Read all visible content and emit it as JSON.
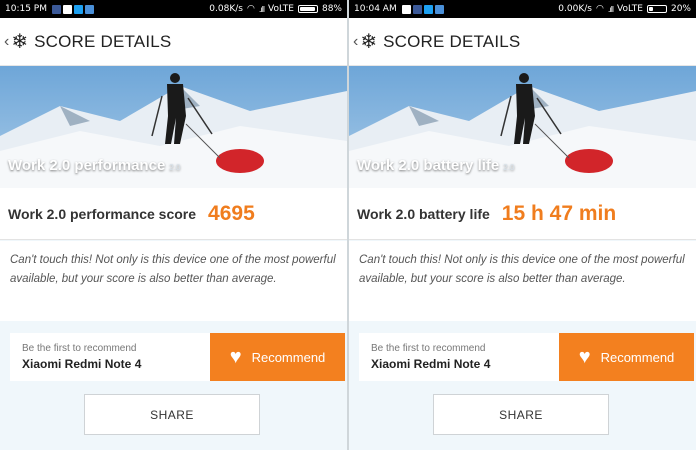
{
  "screens": [
    {
      "status": {
        "time": "10:15 PM",
        "net": "0.08K/s",
        "volte": "VoLTE",
        "battery": "88%",
        "battery_level": 0.88
      },
      "appbar": {
        "back_icon": "chevron-left-icon",
        "logo_icon": "snowflake-icon",
        "title": "SCORE DETAILS"
      },
      "hero": {
        "title": "Work 2.0 performance",
        "version": "2.0"
      },
      "score": {
        "label": "Work 2.0 performance score",
        "value": "4695"
      },
      "description": "Can't touch this! Not only is this device one of the most powerful available, but your score is also better than average.",
      "recommend": {
        "first": "Be the first to recommend",
        "device": "Xiaomi Redmi Note 4",
        "button": "Recommend"
      },
      "share": "SHARE"
    },
    {
      "status": {
        "time": "10:04 AM",
        "net": "0.00K/s",
        "volte": "VoLTE",
        "battery": "20%",
        "battery_level": 0.2
      },
      "appbar": {
        "back_icon": "chevron-left-icon",
        "logo_icon": "snowflake-icon",
        "title": "SCORE DETAILS"
      },
      "hero": {
        "title": "Work 2.0 battery life",
        "version": "2.0"
      },
      "score": {
        "label": "Work 2.0 battery life",
        "value": "15 h 47 min"
      },
      "description": "Can't touch this! Not only is this device one of the most powerful available, but your score is also better than average.",
      "recommend": {
        "first": "Be the first to recommend",
        "device": "Xiaomi Redmi Note 4",
        "button": "Recommend"
      },
      "share": "SHARE"
    }
  ],
  "colors": {
    "accent": "#f3801f",
    "score_text": "#f07d1e",
    "page_bg": "#f0f7fb",
    "statusbar": "#000000"
  }
}
